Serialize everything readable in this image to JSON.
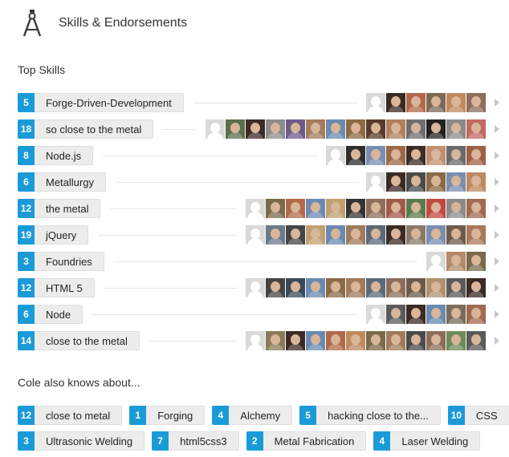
{
  "header": {
    "title": "Skills & Endorsements",
    "icon": "compass-icon"
  },
  "top_skills": {
    "heading": "Top Skills",
    "skills": [
      {
        "count": "5",
        "name": "Forge-Driven-Development",
        "avatars": [
          "blank",
          "#3a2a22",
          "#b06a4a",
          "#7d6a55",
          "#c08a5e",
          "#8d6e5a"
        ]
      },
      {
        "count": "18",
        "name": "so close to the metal",
        "avatars": [
          "blank",
          "#5c6e4a",
          "#3b2a25",
          "#8c8c8c",
          "#6e5a8a",
          "#a57c5c",
          "#6a8ab0",
          "#8b6a45",
          "#5a3a2a",
          "#b08060",
          "#6e6e6e",
          "#222222",
          "#8a8a8a",
          "#c06a60"
        ]
      },
      {
        "count": "8",
        "name": "Node.js",
        "avatars": [
          "blank",
          "#2e2e2e",
          "#7a8fb0",
          "#9b6a48",
          "#3a2c26",
          "#c09070",
          "#6a6a6a",
          "#a06048"
        ]
      },
      {
        "count": "6",
        "name": "Metallurgy",
        "avatars": [
          "blank",
          "#3b2a25",
          "#4a4a4a",
          "#8b6a45",
          "#7a8fb0",
          "#c08a5e"
        ]
      },
      {
        "count": "12",
        "name": "the metal",
        "avatars": [
          "blank",
          "#7a6a4a",
          "#b06a4a",
          "#6a8ab0",
          "#c0a070",
          "#333333",
          "#8d6e5a",
          "#a05a48",
          "#5a7a4a",
          "#c04a40",
          "#8b8b8b",
          "#a06a50"
        ]
      },
      {
        "count": "19",
        "name": "jQuery",
        "avatars": [
          "blank",
          "#6a7a8a",
          "#444444",
          "#c0a070",
          "#6a8ab0",
          "#a07a5a",
          "#5a6a7a",
          "#3b2a25",
          "#8b7a6a",
          "#7a8fb0",
          "#6e5a4a",
          "#aa7a5a"
        ]
      },
      {
        "count": "3",
        "name": "Foundries",
        "avatars": [
          "blank",
          "#b08a6a",
          "#7a6a4a"
        ]
      },
      {
        "count": "12",
        "name": "HTML 5",
        "avatars": [
          "blank",
          "#444444",
          "#3b4a5a",
          "#6a8ab0",
          "#8b6a45",
          "#a07a5a",
          "#5a6a7a",
          "#8d6e5a",
          "#6e5a4a",
          "#b09070",
          "#5a5a5a",
          "#3b2a25"
        ]
      },
      {
        "count": "6",
        "name": "Node",
        "avatars": [
          "blank",
          "#5a5a5a",
          "#3b2a25",
          "#6a8ab0",
          "#7a6a5a",
          "#a06a50"
        ]
      },
      {
        "count": "14",
        "name": "close to the metal",
        "avatars": [
          "blank",
          "#8a7a5a",
          "#3b2a25",
          "#6a8ab0",
          "#b06a4a",
          "#c08a5e",
          "#7a6a4a",
          "#a07a5a",
          "#4a4a4a",
          "#8d6e5a",
          "#6e8a5a",
          "#5a5a5a"
        ]
      }
    ]
  },
  "also_knows": {
    "heading": "Cole also knows about...",
    "rows": [
      [
        {
          "count": "12",
          "name": "close to metal"
        },
        {
          "count": "1",
          "name": "Forging"
        },
        {
          "count": "4",
          "name": "Alchemy"
        },
        {
          "count": "5",
          "name": "hacking close to the..."
        },
        {
          "count": "10",
          "name": "CSS"
        }
      ],
      [
        {
          "count": "3",
          "name": "Ultrasonic Welding"
        },
        {
          "count": "7",
          "name": "html5css3"
        },
        {
          "count": "2",
          "name": "Metal Fabrication"
        },
        {
          "count": "4",
          "name": "Laser Welding"
        }
      ]
    ]
  },
  "colors": {
    "count_badge": "#1a9bd8",
    "pill_bg": "#ececec"
  }
}
